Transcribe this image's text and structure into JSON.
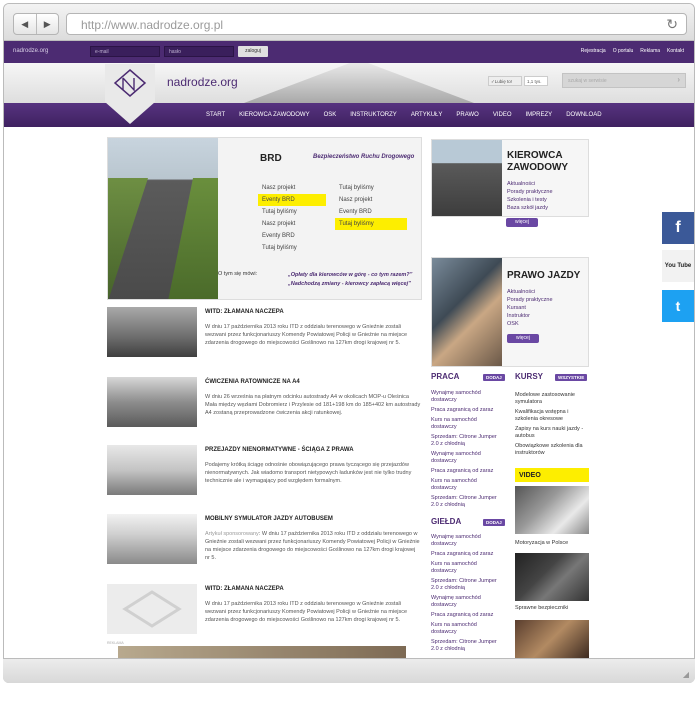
{
  "browser": {
    "url": "http://www.nadrodze.org.pl",
    "back": "◀",
    "forward": "▶",
    "reload": "↻"
  },
  "topbar": {
    "brand": "nadrodze.org",
    "email_placeholder": "e-mail",
    "password_placeholder": "hasło",
    "login_label": "zaloguj",
    "links": [
      "Rejestracja",
      "O portalu",
      "Reklama",
      "Kontakt"
    ]
  },
  "header": {
    "site_name": "nadrodze.org",
    "like_label": "Lubię to!",
    "like_count": "1,1 tys.",
    "search_placeholder": "szukaj w serwisie"
  },
  "menu": [
    "START",
    "KIEROWCA ZAWODOWY",
    "OSK",
    "INSTRUKTORZY",
    "ARTYKUŁY",
    "PRAWO",
    "VIDEO",
    "IMPREZY",
    "DOWNLOAD"
  ],
  "brd": {
    "title": "BRD",
    "subtitle": "Bezpieczeństwo Ruchu Drogowego",
    "col1": [
      "Nasz projekt",
      "Eventy BRD",
      "Tutaj byliśmy",
      "Nasz projekt",
      "Eventy BRD",
      "Tutaj byliśmy"
    ],
    "col2": [
      "Tutaj byliśmy",
      "Nasz projekt",
      "Eventy BRD",
      "Tutaj byliśmy"
    ],
    "mowi": "O tym się mówi:",
    "quote1": "„Opłaty dla kierowców w górę - co tym razem?”",
    "quote2": "„Nadchodzą zmiany - kierowcy zapłacą więcej”"
  },
  "kierowca": {
    "title1": "KIEROWCA",
    "title2": "ZAWODOWY",
    "items": [
      "Aktualności",
      "Porady praktyczne",
      "Szkolenia i testy",
      "Baza szkół jazdy"
    ],
    "button": "więcej"
  },
  "prawo": {
    "title": "PRAWO JAZDY",
    "items": [
      "Aktualności",
      "Porady praktyczne",
      "Kursant",
      "Instruktor",
      "OSK"
    ],
    "button": "więcej"
  },
  "news": [
    {
      "title": "WITD: ZŁAMANA NACZEPA",
      "prefix": "",
      "body": "W dniu 17 października 2013 roku ITD z oddziału terenowego w Gnieźnie zostali wezwani przez funkcjonariuszy Komendy Powiatowej Policji w Gnieźnie na miejsce zdarzenia drogowego do miejscowości Goślinowo na 127km drogi krajowej nr 5."
    },
    {
      "title": "ĆWICZENIA RATOWNICZE NA A4",
      "prefix": "",
      "body": "W dniu 26 września na płatnym odcinku autostrady A4 w okolicach MOP-u Oleśnica Mała między węzłami Dobromierz i Przylesie od 181+198 km do 185+402 km autostrady A4 zostaną przeprowadzone ćwiczenia akcji ratunkowej."
    },
    {
      "title": "PRZEJAZDY NIENORMATYWNE - ŚCIĄGA Z PRAWA",
      "prefix": "",
      "body": "Podajemy krótką ściągę odnośnie obowiązującego prawa tyczącego się przejazdów nienormatywnych. Jak wiadomo transport nietypowych ładunków jest nie tylko trudny technicznie ale i wymagający pod względem formalnym."
    },
    {
      "title": "MOBILNY SYMULATOR JAZDY AUTOBUSEM",
      "prefix": "Artykuł sponsorowany",
      "body": "W dniu 17 października 2013 roku ITD z oddziału terenowego w Gnieźnie zostali wezwani przez funkcjonariuszy Komendy Powiatowej Policji w Gnieźnie na miejsce zdarzenia drogowego do miejscowości Goślinowo na 127km drogi krajowej nr 5."
    },
    {
      "title": "WITD: ZŁAMANA NACZEPA",
      "prefix": "",
      "body": "W dniu 17 października 2013 roku ITD z oddziału terenowego w Gnieźnie zostali wezwani przez funkcjonariuszy Komendy Powiatowej Policji w Gnieźnie na miejsce zdarzenia drogowego do miejscowości Goślinowo na 127km drogi krajowej nr 5."
    }
  ],
  "praca": {
    "title": "PRACA",
    "badge": "DODAJ",
    "items": [
      "Wynajmę samochód dostawczy",
      "Praca zagranicą od zaraz",
      "Kurs na samochód dostawczy",
      "Sprzedam: Citrone Jumper 2.0 z chłodnią",
      "Wynajmę samochód dostawczy",
      "Praca zagranicą od zaraz",
      "Kurs na samochód dostawczy",
      "Sprzedam: Citrone Jumper 2.0 z chłodnią"
    ]
  },
  "gielda": {
    "title": "GIEŁDA",
    "badge": "DODAJ",
    "items": [
      "Wynajmę samochód dostawczy",
      "Praca zagranicą od zaraz",
      "Kurs na samochód dostawczy",
      "Sprzedam: Citrone Jumper 2.0 z chłodnią",
      "Wynajmę samochód dostawczy",
      "Praca zagranicą od zaraz",
      "Kurs na samochód dostawczy",
      "Sprzedam: Citrone Jumper 2.0 z chłodnią"
    ]
  },
  "kursy": {
    "title": "KURSY",
    "badge": "WSZYSTKIE",
    "items": [
      "Modelowe zastosowanie symulatora",
      "Kwalifikacja wstępna i szkolenia okresowe",
      "Zapisy na kurs nauki jazdy - autobus",
      "Obowiązkowe szkolenia dla instruktorów"
    ]
  },
  "video": {
    "title": "VIDEO",
    "items": [
      "Motoryzacja w Polsce",
      "Sprawne bezpieczniki"
    ]
  },
  "social": {
    "facebook": "f",
    "youtube": "You Tube",
    "twitter": "t"
  },
  "ad_label": "REKLAMA"
}
